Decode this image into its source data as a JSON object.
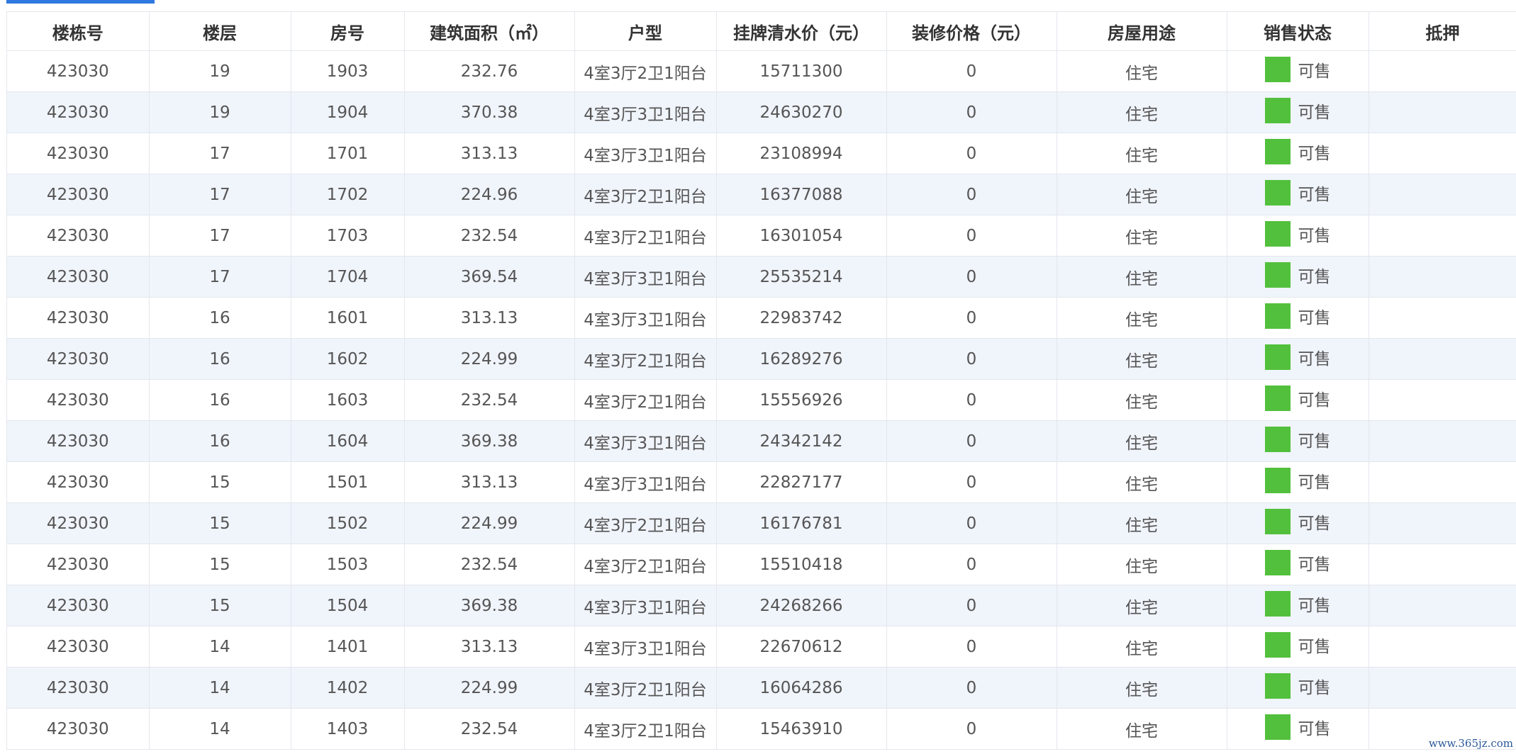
{
  "table": {
    "columns": [
      "楼栋号",
      "楼层",
      "房号",
      "建筑面积（㎡）",
      "户型",
      "挂牌清水价（元）",
      "装修价格（元）",
      "房屋用途",
      "销售状态",
      "抵押"
    ],
    "rows": [
      [
        "423030",
        "19",
        "1903",
        "232.76",
        "4室3厅2卫1阳台",
        "15711300",
        "0",
        "住宅",
        "可售",
        ""
      ],
      [
        "423030",
        "19",
        "1904",
        "370.38",
        "4室3厅3卫1阳台",
        "24630270",
        "0",
        "住宅",
        "可售",
        ""
      ],
      [
        "423030",
        "17",
        "1701",
        "313.13",
        "4室3厅3卫1阳台",
        "23108994",
        "0",
        "住宅",
        "可售",
        ""
      ],
      [
        "423030",
        "17",
        "1702",
        "224.96",
        "4室3厅2卫1阳台",
        "16377088",
        "0",
        "住宅",
        "可售",
        ""
      ],
      [
        "423030",
        "17",
        "1703",
        "232.54",
        "4室3厅2卫1阳台",
        "16301054",
        "0",
        "住宅",
        "可售",
        ""
      ],
      [
        "423030",
        "17",
        "1704",
        "369.54",
        "4室3厅3卫1阳台",
        "25535214",
        "0",
        "住宅",
        "可售",
        ""
      ],
      [
        "423030",
        "16",
        "1601",
        "313.13",
        "4室3厅3卫1阳台",
        "22983742",
        "0",
        "住宅",
        "可售",
        ""
      ],
      [
        "423030",
        "16",
        "1602",
        "224.99",
        "4室3厅2卫1阳台",
        "16289276",
        "0",
        "住宅",
        "可售",
        ""
      ],
      [
        "423030",
        "16",
        "1603",
        "232.54",
        "4室3厅2卫1阳台",
        "15556926",
        "0",
        "住宅",
        "可售",
        ""
      ],
      [
        "423030",
        "16",
        "1604",
        "369.38",
        "4室3厅3卫1阳台",
        "24342142",
        "0",
        "住宅",
        "可售",
        ""
      ],
      [
        "423030",
        "15",
        "1501",
        "313.13",
        "4室3厅3卫1阳台",
        "22827177",
        "0",
        "住宅",
        "可售",
        ""
      ],
      [
        "423030",
        "15",
        "1502",
        "224.99",
        "4室3厅2卫1阳台",
        "16176781",
        "0",
        "住宅",
        "可售",
        ""
      ],
      [
        "423030",
        "15",
        "1503",
        "232.54",
        "4室3厅2卫1阳台",
        "15510418",
        "0",
        "住宅",
        "可售",
        ""
      ],
      [
        "423030",
        "15",
        "1504",
        "369.38",
        "4室3厅3卫1阳台",
        "24268266",
        "0",
        "住宅",
        "可售",
        ""
      ],
      [
        "423030",
        "14",
        "1401",
        "313.13",
        "4室3厅3卫1阳台",
        "22670612",
        "0",
        "住宅",
        "可售",
        ""
      ],
      [
        "423030",
        "14",
        "1402",
        "224.99",
        "4室3厅2卫1阳台",
        "16064286",
        "0",
        "住宅",
        "可售",
        ""
      ],
      [
        "423030",
        "14",
        "1403",
        "232.54",
        "4室3厅2卫1阳台",
        "15463910",
        "0",
        "住宅",
        "可售",
        ""
      ]
    ]
  },
  "status_color": "#52c03c",
  "watermark": "www.365jz.com"
}
